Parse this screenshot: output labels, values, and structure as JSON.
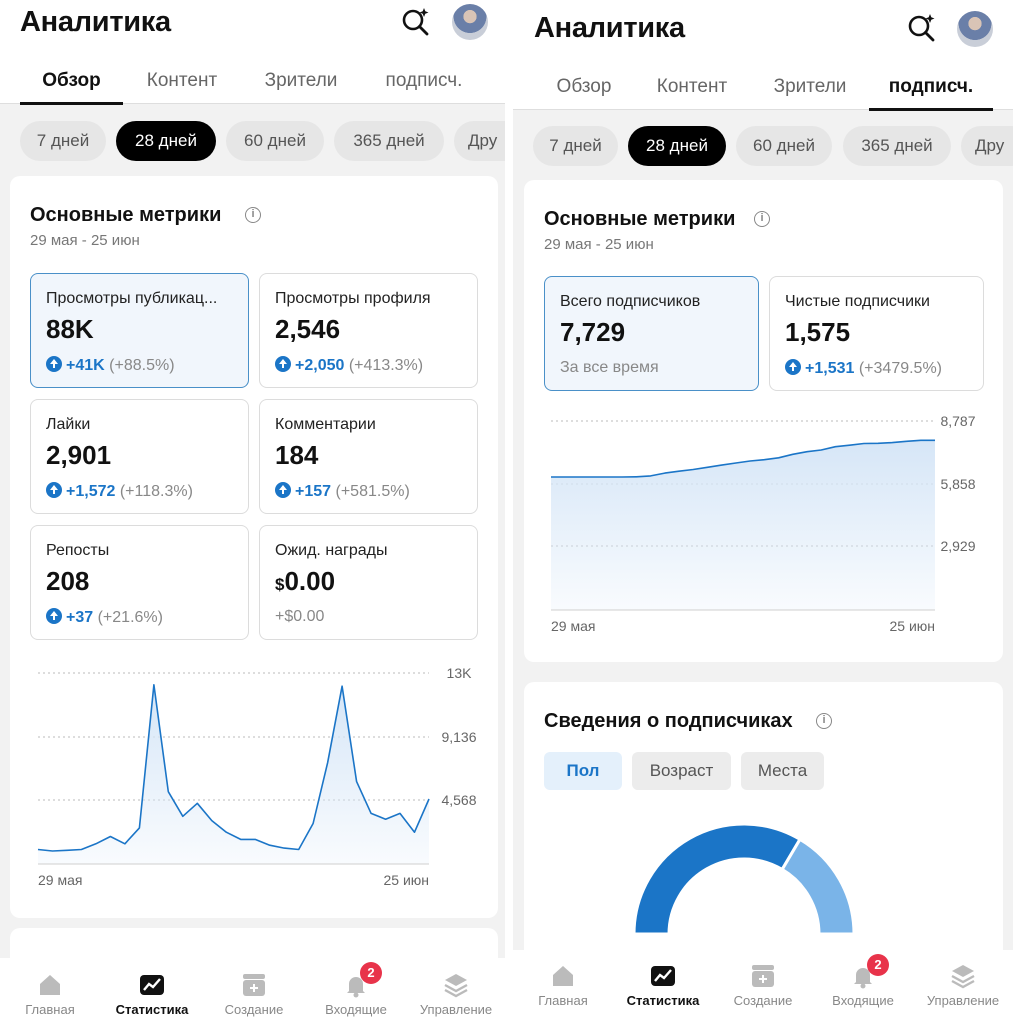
{
  "left": {
    "title": "Аналитика",
    "tabs": [
      "Обзор",
      "Контент",
      "Зрители",
      "подписч."
    ],
    "active_tab": 0,
    "chips": [
      "7 дней",
      "28 дней",
      "60 дней",
      "365 дней",
      "Дру"
    ],
    "active_chip": 1,
    "card_title": "Основные метрики",
    "date_range": "29 мая - 25 июн",
    "metrics": [
      {
        "label": "Просмотры публикац...",
        "value": "88K",
        "delta": "+41K",
        "pct": "(+88.5%)",
        "selected": true
      },
      {
        "label": "Просмотры профиля",
        "value": "2,546",
        "delta": "+2,050",
        "pct": "(+413.3%)"
      },
      {
        "label": "Лайки",
        "value": "2,901",
        "delta": "+1,572",
        "pct": "(+118.3%)"
      },
      {
        "label": "Комментарии",
        "value": "184",
        "delta": "+157",
        "pct": "(+581.5%)"
      },
      {
        "label": "Репосты",
        "value": "208",
        "delta": "+37",
        "pct": "(+21.6%)"
      },
      {
        "label": "Ожид. награды",
        "currency": "$",
        "value": "0.00",
        "sub": "+$0.00"
      }
    ],
    "badge_count": "2"
  },
  "right": {
    "title": "Аналитика",
    "tabs": [
      "Обзор",
      "Контент",
      "Зрители",
      "подписч."
    ],
    "active_tab": 3,
    "chips": [
      "7 дней",
      "28 дней",
      "60 дней",
      "365 дней",
      "Дру"
    ],
    "active_chip": 1,
    "card_title": "Основные метрики",
    "date_range": "29 мая - 25 июн",
    "metrics": [
      {
        "label": "Всего подписчиков",
        "value": "7,729",
        "sub": "За все время",
        "selected": true
      },
      {
        "label": "Чистые подписчики",
        "value": "1,575",
        "delta": "+1,531",
        "pct": "(+3479.5%)"
      }
    ],
    "followers_title": "Сведения о подписчиках",
    "segments": [
      "Пол",
      "Возраст",
      "Места"
    ],
    "active_segment": 0,
    "badge_count": "2"
  },
  "nav": [
    "Главная",
    "Статистика",
    "Создание",
    "Входящие",
    "Управление"
  ],
  "active_nav": 1,
  "colors": {
    "accent": "#1b75c7",
    "badge": "#e8334a",
    "area_fill": "#d6e6f7",
    "donut_dark": "#1b75c7",
    "donut_light": "#7ab4e8"
  },
  "chart_data": [
    {
      "type": "area",
      "title": "",
      "x_start_label": "29 мая",
      "x_end_label": "25 июн",
      "y_ticks": [
        "13K",
        "9,136",
        "4,568"
      ],
      "ylim": [
        0,
        13700
      ],
      "values": [
        1000,
        900,
        950,
        1000,
        1400,
        1900,
        1400,
        2500,
        12400,
        5000,
        3300,
        4200,
        3000,
        2200,
        1700,
        1700,
        1300,
        1100,
        1000,
        2800,
        7000,
        12300,
        5700,
        3500,
        3100,
        3500,
        2200,
        4500
      ]
    },
    {
      "type": "area",
      "title": "",
      "x_start_label": "29 мая",
      "x_end_label": "25 июн",
      "y_ticks": [
        "8,787",
        "5,858",
        "2,929"
      ],
      "ylim": [
        0,
        8787
      ],
      "values": [
        6150,
        6150,
        6150,
        6150,
        6150,
        6150,
        6160,
        6200,
        6330,
        6420,
        6500,
        6600,
        6700,
        6800,
        6890,
        6950,
        7040,
        7200,
        7320,
        7400,
        7550,
        7620,
        7700,
        7710,
        7740,
        7800,
        7850,
        7850
      ]
    },
    {
      "type": "pie",
      "title": "",
      "categories": [
        "",
        ""
      ],
      "values": [
        67,
        33
      ]
    }
  ]
}
